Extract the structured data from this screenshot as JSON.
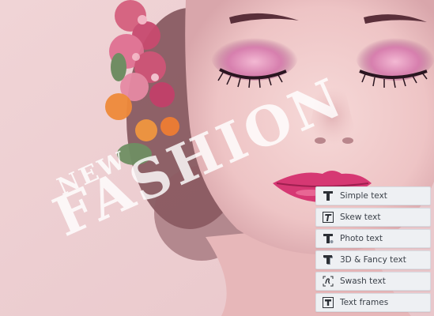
{
  "watermark": {
    "line1": "NEW",
    "line2": "FASHION"
  },
  "text_menu": {
    "items": [
      {
        "label": "Simple text",
        "icon": "simple-text-icon"
      },
      {
        "label": "Skew text",
        "icon": "skew-text-icon"
      },
      {
        "label": "Photo text",
        "icon": "photo-text-icon"
      },
      {
        "label": "3D & Fancy text",
        "icon": "3d-fancy-text-icon"
      },
      {
        "label": "Swash text",
        "icon": "swash-text-icon"
      },
      {
        "label": "Text frames",
        "icon": "text-frames-icon"
      }
    ]
  },
  "colors": {
    "background": "#eccfd2",
    "menu_item_bg": "#eef0f3",
    "menu_text": "#3b4149",
    "icon": "#2c3036"
  }
}
